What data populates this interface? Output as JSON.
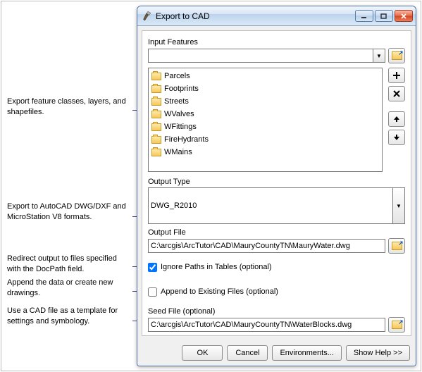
{
  "window": {
    "title": "Export to CAD"
  },
  "annotations": {
    "a1": "Export feature classes, layers, and shapefiles.",
    "a2": "Export to AutoCAD DWG/DXF and MicroStation V8 formats.",
    "a3": "Redirect output to files specified with the DocPath field.",
    "a4": "Append the data or create new drawings.",
    "a5": "Use a CAD file as a template for settings and symbology."
  },
  "labels": {
    "input_features": "Input Features",
    "output_type": "Output Type",
    "output_file": "Output File",
    "ignore_paths": "Ignore Paths in Tables (optional)",
    "append": "Append to Existing Files (optional)",
    "seed_file": "Seed File (optional)"
  },
  "values": {
    "input_combo": "",
    "output_type": "DWG_R2010",
    "output_file": "C:\\arcgis\\ArcTutor\\CAD\\MauryCountyTN\\MauryWater.dwg",
    "seed_file": "C:\\arcgis\\ArcTutor\\CAD\\MauryCountyTN\\WaterBlocks.dwg",
    "ignore_paths_checked": true,
    "append_checked": false
  },
  "feature_list": [
    "Parcels",
    "Footprints",
    "Streets",
    "WValves",
    "WFittings",
    "FireHydrants",
    "WMains"
  ],
  "buttons": {
    "ok": "OK",
    "cancel": "Cancel",
    "env": "Environments...",
    "help": "Show Help >>"
  }
}
